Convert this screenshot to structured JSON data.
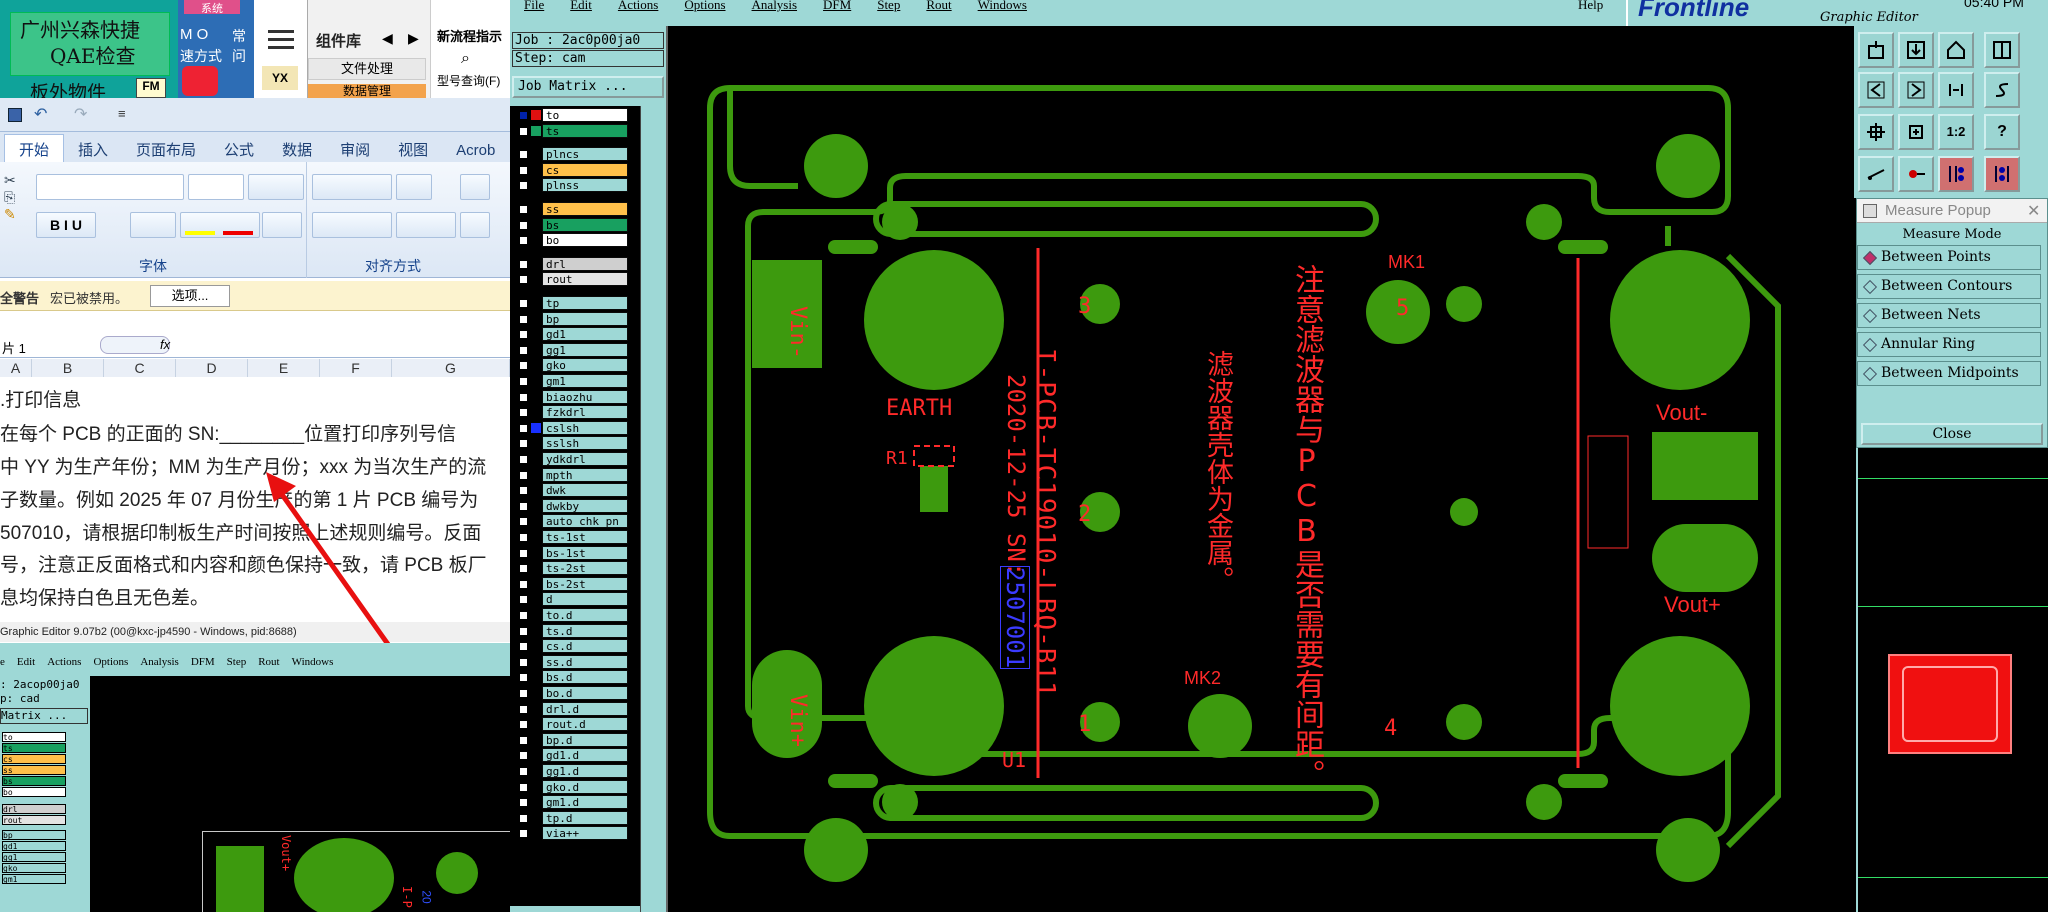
{
  "top_left_app": {
    "line1": "广州兴森快捷",
    "line2": "QAE检查",
    "line3": "板外物件",
    "badge": "FM"
  },
  "taskbar_small": {
    "label1": "M O",
    "label2": "速方式",
    "label3": "常",
    "label4": "问",
    "top_pink": "系统"
  },
  "group_panel": {
    "title": "组件库",
    "item1": "文件处理",
    "item2": "数据管理",
    "side_icon": "YX",
    "new_flow": "新流程指示",
    "model_query": "型号查询(F)"
  },
  "excel": {
    "tabs": [
      "开始",
      "插入",
      "页面布局",
      "公式",
      "数据",
      "审阅",
      "视图",
      "Acrob"
    ],
    "groups": {
      "font": "字体",
      "align": "对齐方式"
    },
    "security": {
      "label": "全警告",
      "text": "宏已被禁用。",
      "button": "选项..."
    },
    "namebox": "片 1",
    "fx": "fx",
    "columns": [
      "A",
      "B",
      "C",
      "D",
      "E",
      "F",
      "G"
    ],
    "doc_lines": [
      ".打印信息",
      "     在每个 PCB 的正面的 SN:________位置打印序列号信",
      "中 YY 为生产年份；MM 为生产月份；xxx 为当次生产的流",
      "子数量。例如 2025 年 07 月份生产的第 1 片 PCB 编号为",
      "507010，请根据印制板生产时间按照上述规则编号。反面",
      "号，注意正反面格式和内容和颜色保持一致，请 PCB 板厂",
      "息均保持白色且无色差。"
    ],
    "status": "Graphic Editor 9.07b2 (00@kxc-jp4590 - Windows, pid:8688)"
  },
  "genesis_back": {
    "menu": [
      "e",
      "Edit",
      "Actions",
      "Options",
      "Analysis",
      "DFM",
      "Step",
      "Rout",
      "Windows"
    ],
    "job": ": 2acop00ja0",
    "step": "p: cad",
    "matrix": "Matrix ...",
    "layers": [
      "to",
      "ts",
      "cs",
      "ss",
      "bs",
      "bo",
      "drl",
      "rout",
      "bp",
      "gd1",
      "gg1",
      "gko",
      "gm1"
    ],
    "pcb_text1": "Vout+",
    "pcb_text2": "I-P",
    "pcb_text3": "20"
  },
  "genesis": {
    "menu": [
      "File",
      "Edit",
      "Actions",
      "Options",
      "Analysis",
      "DFM",
      "Step",
      "Rout",
      "Windows"
    ],
    "help": "Help",
    "brand": "Frontline",
    "subtitle": "Graphic Editor",
    "clock": "05:40 PM",
    "job": "Job : 2ac0p00ja0",
    "step": "Step: cam",
    "matrix": "Job Matrix ...",
    "layers": [
      {
        "name": "to",
        "color": "#ffffff"
      },
      {
        "name": "ts",
        "color": "#18a060"
      },
      {
        "name": "plncs",
        "color": "#9ed8d6"
      },
      {
        "name": "cs",
        "color": "#ffc04a"
      },
      {
        "name": "plnss",
        "color": "#9ed8d6"
      },
      {
        "name": "ss",
        "color": "#ffc04a"
      },
      {
        "name": "bs",
        "color": "#18a060"
      },
      {
        "name": "bo",
        "color": "#ffffff"
      },
      {
        "name": "drl",
        "color": "#cfcfcf"
      },
      {
        "name": "rout",
        "color": "#e3e3e3"
      },
      {
        "name": "tp",
        "color": "#9ed8d6"
      },
      {
        "name": "bp",
        "color": "#9ed8d6"
      },
      {
        "name": "gd1",
        "color": "#9ed8d6"
      },
      {
        "name": "gg1",
        "color": "#9ed8d6"
      },
      {
        "name": "gko",
        "color": "#9ed8d6"
      },
      {
        "name": "gm1",
        "color": "#9ed8d6"
      },
      {
        "name": "biaozhu",
        "color": "#9ed8d6"
      },
      {
        "name": "fzkdrl",
        "color": "#9ed8d6"
      },
      {
        "name": "cslsh",
        "color": "#9ed8d6"
      },
      {
        "name": "sslsh",
        "color": "#9ed8d6"
      },
      {
        "name": "ydkdrl",
        "color": "#9ed8d6"
      },
      {
        "name": "mpth",
        "color": "#9ed8d6"
      },
      {
        "name": "dwk",
        "color": "#9ed8d6"
      },
      {
        "name": "dwkby",
        "color": "#9ed8d6"
      },
      {
        "name": "auto_chk_pn",
        "color": "#9ed8d6"
      },
      {
        "name": "ts-1st",
        "color": "#9ed8d6"
      },
      {
        "name": "bs-1st",
        "color": "#9ed8d6"
      },
      {
        "name": "ts-2st",
        "color": "#9ed8d6"
      },
      {
        "name": "bs-2st",
        "color": "#9ed8d6"
      },
      {
        "name": "d",
        "color": "#9ed8d6"
      },
      {
        "name": "to.d",
        "color": "#9ed8d6"
      },
      {
        "name": "ts.d",
        "color": "#9ed8d6"
      },
      {
        "name": "cs.d",
        "color": "#9ed8d6"
      },
      {
        "name": "ss.d",
        "color": "#9ed8d6"
      },
      {
        "name": "bs.d",
        "color": "#9ed8d6"
      },
      {
        "name": "bo.d",
        "color": "#9ed8d6"
      },
      {
        "name": "drl.d",
        "color": "#9ed8d6"
      },
      {
        "name": "rout.d",
        "color": "#9ed8d6"
      },
      {
        "name": "bp.d",
        "color": "#9ed8d6"
      },
      {
        "name": "gd1.d",
        "color": "#9ed8d6"
      },
      {
        "name": "gg1.d",
        "color": "#9ed8d6"
      },
      {
        "name": "gko.d",
        "color": "#9ed8d6"
      },
      {
        "name": "gm1.d",
        "color": "#9ed8d6"
      },
      {
        "name": "tp.d",
        "color": "#9ed8d6"
      },
      {
        "name": "via++",
        "color": "#9ed8d6"
      }
    ]
  },
  "pcb": {
    "vin_minus": "Vin-",
    "vin_plus": "Vin+",
    "earth": "EARTH",
    "r1": "R1",
    "u1": "U1",
    "pcb_id": "I-PCB-TC19010-LBQ-B11",
    "date_sn": "2020-12-25 SN:",
    "sn_value": "2507001",
    "filter_note": "滤波器壳体为金属。",
    "note": "注意滤波器与PCB是否需要有间距。",
    "mk1": "MK1",
    "mk2": "MK2",
    "n1": "1",
    "n2": "2",
    "n3": "3",
    "n4": "4",
    "n5": "5",
    "vout_minus": "Vout-",
    "vout_plus": "Vout+"
  },
  "measure_popup": {
    "title": "Measure Popup",
    "mode": "Measure Mode",
    "items": [
      "Between Points",
      "Between Contours",
      "Between Nets",
      "Annular Ring",
      "Between Midpoints"
    ],
    "close": "Close"
  },
  "colors": {
    "pcb_green": "#3d9a0e",
    "silk_red": "#ff2a2a",
    "gen_bg": "#9ed8d6"
  }
}
